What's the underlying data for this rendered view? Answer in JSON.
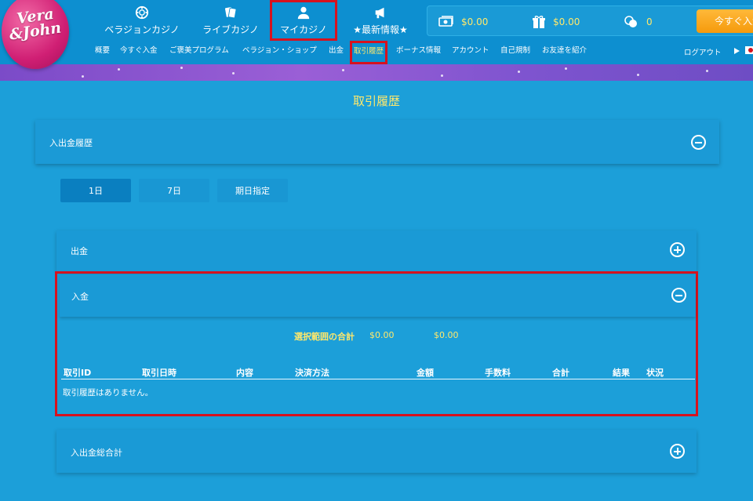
{
  "brand": {
    "line1": "Vera",
    "line2": "&John"
  },
  "main_nav": [
    {
      "label": "ベラジョンカジノ",
      "icon": "chip-icon"
    },
    {
      "label": "ライブカジノ",
      "icon": "cards-icon"
    },
    {
      "label": "マイカジノ",
      "icon": "user-icon",
      "active": true
    },
    {
      "label": "★最新情報★",
      "icon": "megaphone-icon"
    }
  ],
  "wallet": {
    "cash": "$0.00",
    "bonus": "$0.00",
    "points": "0",
    "deposit_button": "今すぐ入金"
  },
  "sub_nav": [
    {
      "label": "概要"
    },
    {
      "label": "今すぐ入金"
    },
    {
      "label": "ご褒美プログラム"
    },
    {
      "label": "ベラジョン・ショップ"
    },
    {
      "label": "出金"
    },
    {
      "label": "取引履歴",
      "active": true
    },
    {
      "label": "ボーナス情報"
    },
    {
      "label": "アカウント"
    },
    {
      "label": "自己規制"
    },
    {
      "label": "お友達を紹介"
    }
  ],
  "logout": "ログアウト",
  "page_title": "取引履歴",
  "history_panel": {
    "title": "入出金履歴"
  },
  "filters": [
    {
      "label": "1日",
      "selected": true
    },
    {
      "label": "7日"
    },
    {
      "label": "期日指定"
    }
  ],
  "withdrawal_section": {
    "title": "出金"
  },
  "deposit_section": {
    "title": "入金",
    "summary_label": "選択範囲の合計",
    "summary_value_1": "$0.00",
    "summary_value_2": "$0.00",
    "columns": [
      "取引ID",
      "取引日時",
      "内容",
      "決済方法",
      "金額",
      "手数料",
      "合計",
      "結果",
      "状況"
    ],
    "empty_message": "取引履歴はありません。"
  },
  "total_section": {
    "title": "入出金総合計"
  },
  "colors": {
    "background": "#1c9fd9",
    "header": "#0d8fd0",
    "accent_yellow": "#ffe86b",
    "highlight_red": "#d6121f",
    "deposit_orange": "#f59a0c",
    "brand_pink": "#d01f74"
  }
}
